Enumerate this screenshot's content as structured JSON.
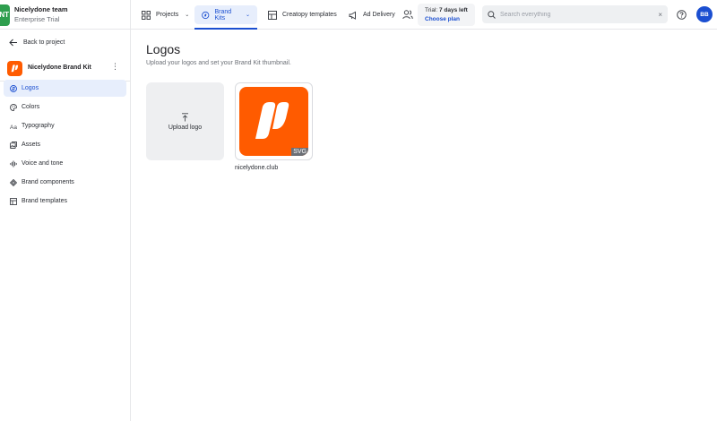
{
  "team": {
    "initials": "NT",
    "name": "Nicelydone team",
    "plan": "Enterprise Trial"
  },
  "nav": {
    "projects": "Projects",
    "brand_kits": "Brand Kits",
    "creatopy_templates": "Creatopy templates",
    "ad_delivery": "Ad Delivery"
  },
  "trial": {
    "prefix": "Trial:",
    "days": "7 days left",
    "choose_plan": "Choose plan"
  },
  "search": {
    "placeholder": "Search everything",
    "clear": "×"
  },
  "user": {
    "initials": "BB"
  },
  "sidebar": {
    "back": "Back to project",
    "kit_name": "Nicelydone Brand Kit",
    "items": [
      {
        "label": "Logos",
        "icon": "logo-icon",
        "active": true
      },
      {
        "label": "Colors",
        "icon": "palette-icon",
        "active": false
      },
      {
        "label": "Typography",
        "icon": "typography-icon",
        "active": false
      },
      {
        "label": "Assets",
        "icon": "assets-icon",
        "active": false
      },
      {
        "label": "Voice and tone",
        "icon": "voice-icon",
        "active": false
      },
      {
        "label": "Brand components",
        "icon": "components-icon",
        "active": false
      },
      {
        "label": "Brand templates",
        "icon": "templates-icon",
        "active": false
      }
    ]
  },
  "main": {
    "title": "Logos",
    "subtitle": "Upload your logos and set your Brand Kit thumbnail.",
    "upload_label": "Upload logo",
    "logo": {
      "badge": "SVG",
      "name": "nicelydone.club"
    }
  },
  "colors": {
    "accent": "#1b4fd1",
    "brand_orange": "#ff5b00",
    "team_green": "#2e9e4e"
  }
}
